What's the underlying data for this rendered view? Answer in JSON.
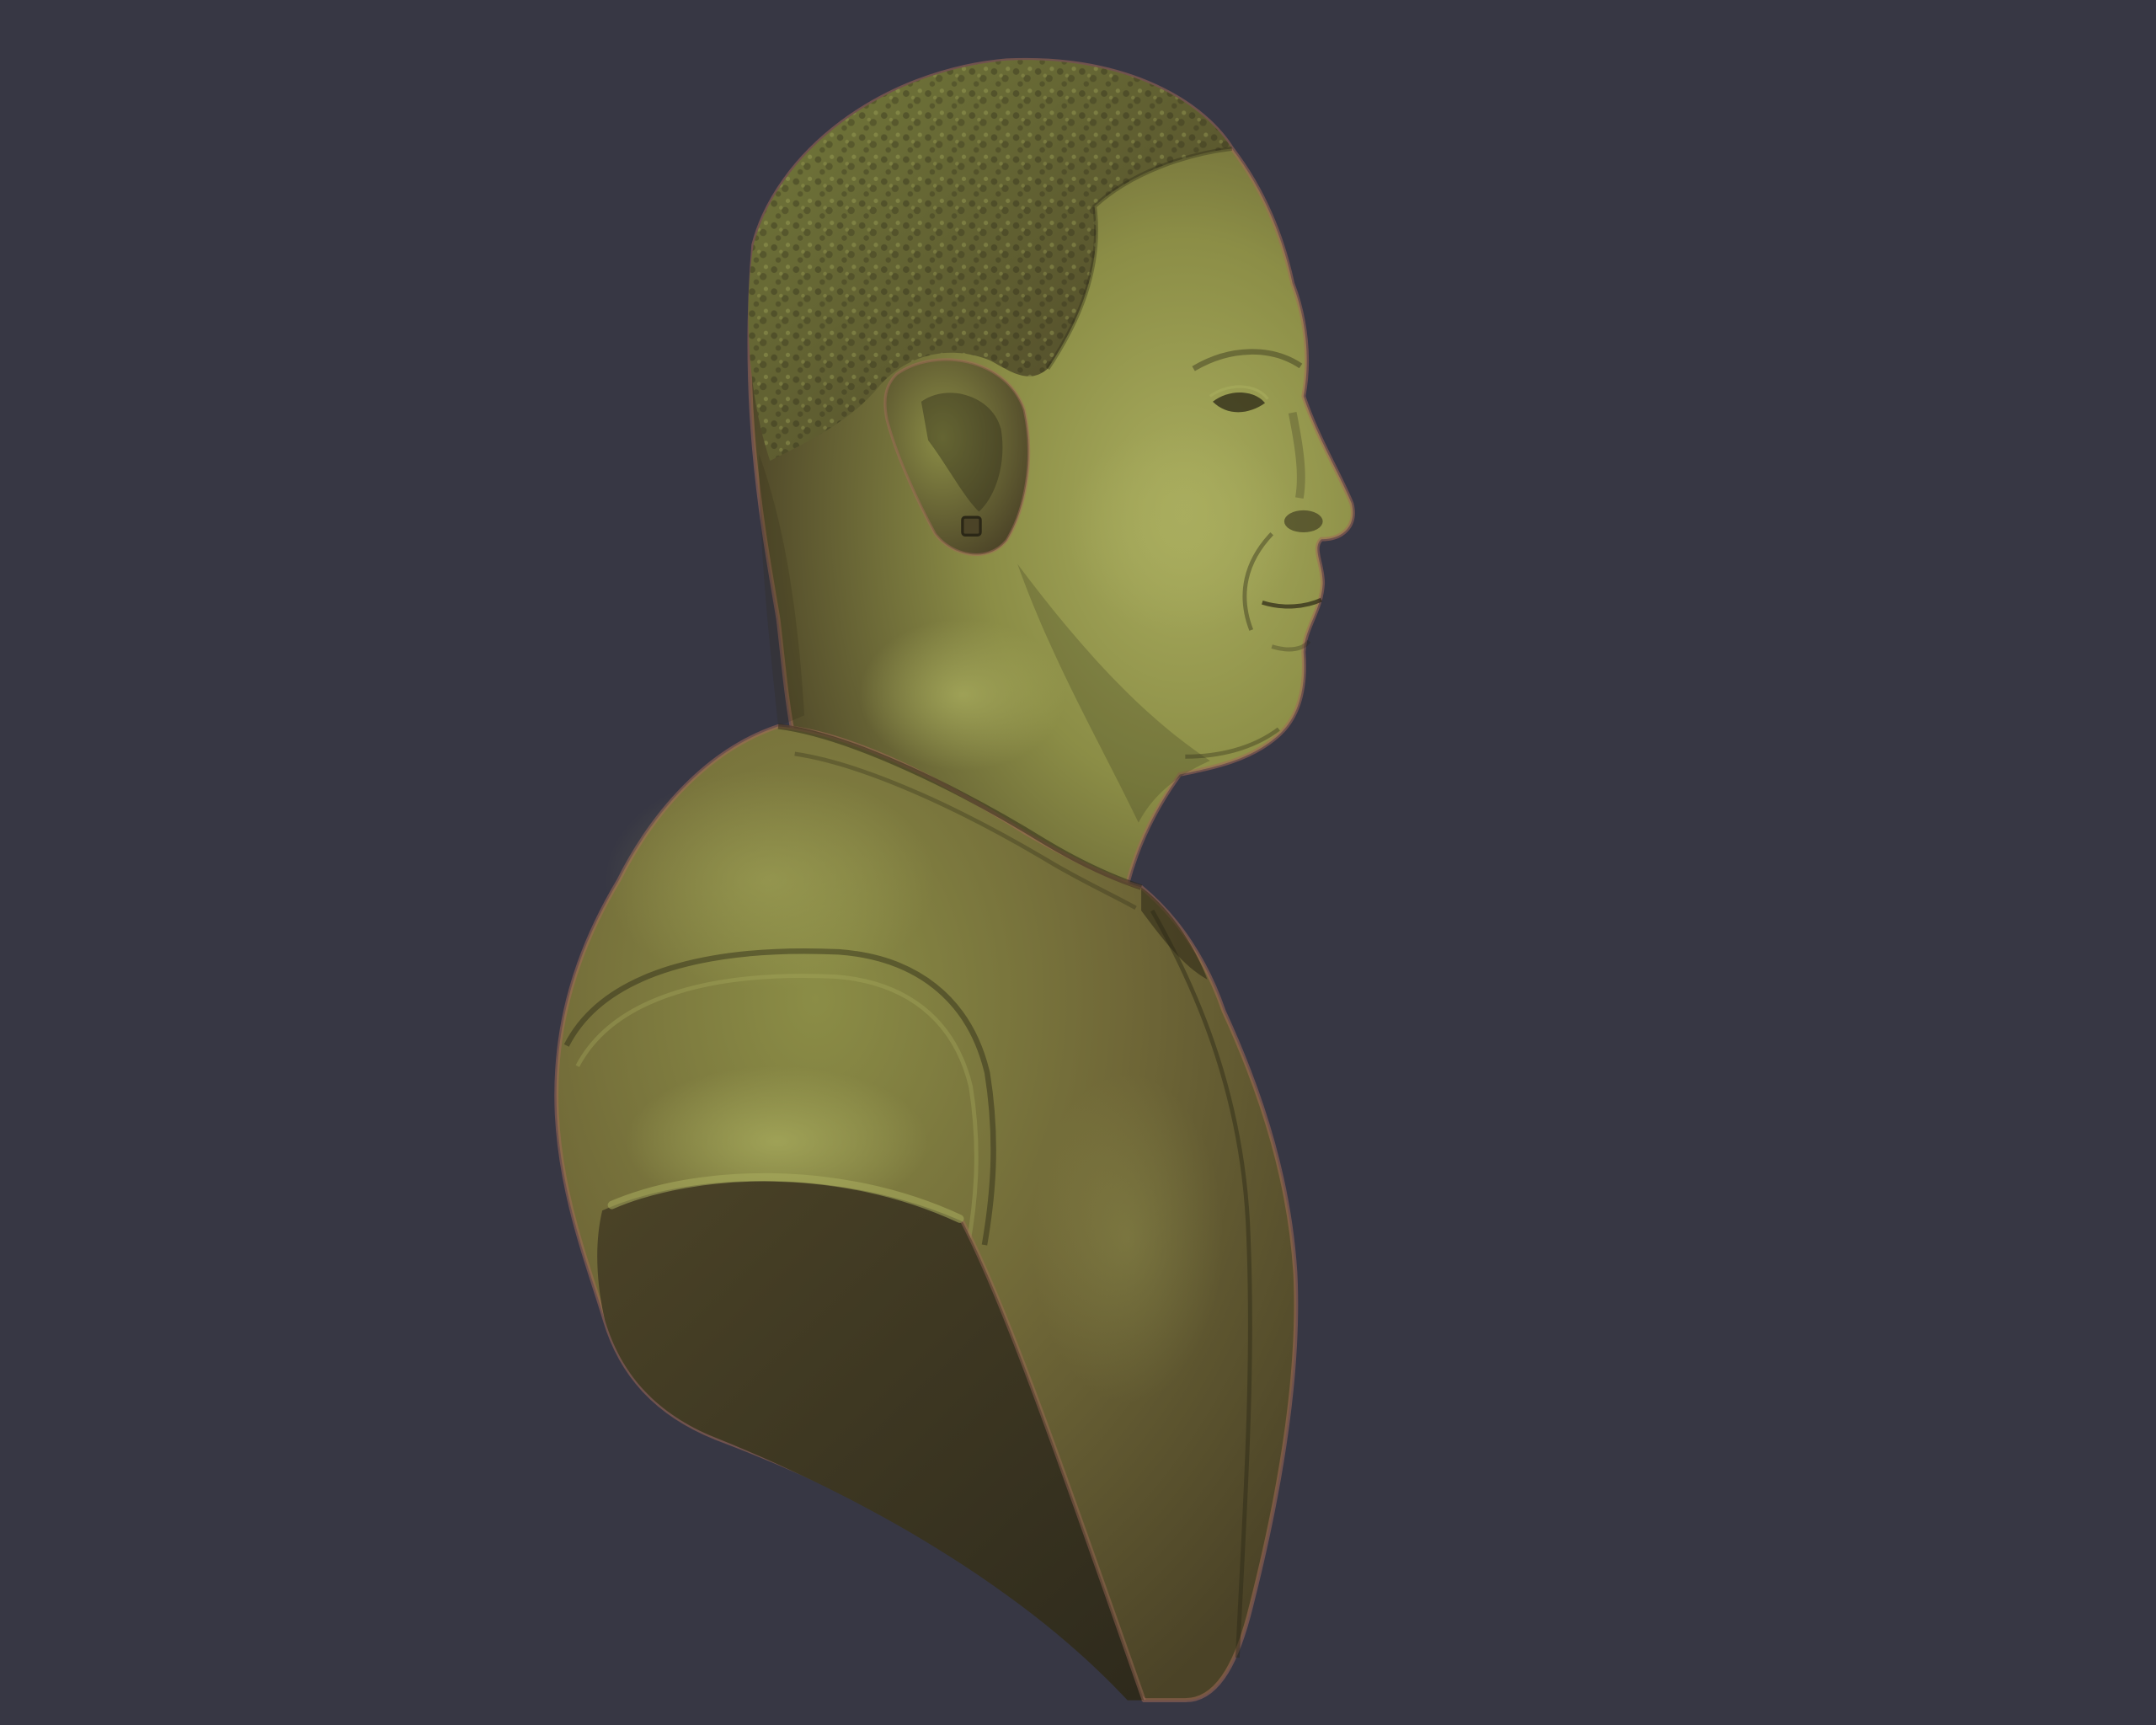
{
  "colors": {
    "background": "#373744",
    "material_highlight": "#a9ad5e",
    "material_light": "#8b8d46",
    "material_mid": "#6f6737",
    "material_dark": "#4b4327",
    "material_shadow": "#2e2a1c",
    "rim_light": "#a06a58",
    "hair": "#747a3b",
    "crease": "#2b2716"
  }
}
